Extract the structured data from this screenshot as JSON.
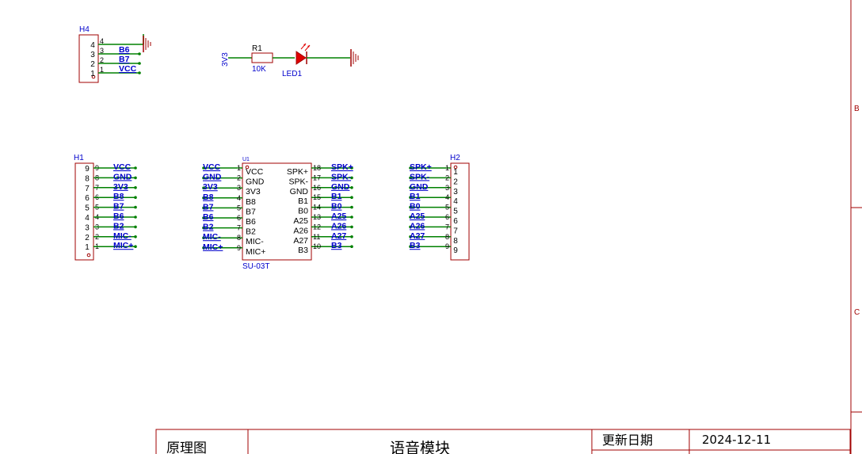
{
  "colors": {
    "body_stroke": "#a00000",
    "wire": "#008000",
    "net_label": "#0000cc",
    "text": "#000000",
    "frame": "#a00000",
    "led_fill": "#e00000"
  },
  "border_letters": [
    "B",
    "C"
  ],
  "h4": {
    "ref": "H4",
    "pins": [
      {
        "num": "4",
        "net": ""
      },
      {
        "num": "3",
        "net": "B6"
      },
      {
        "num": "2",
        "net": "B7"
      },
      {
        "num": "1",
        "net": "VCC"
      }
    ]
  },
  "power": {
    "net": "3V3",
    "resistor_ref": "R1",
    "resistor_value": "10K",
    "led_ref": "LED1"
  },
  "h1": {
    "ref": "H1",
    "pins": [
      {
        "num": "9",
        "net": "VCC"
      },
      {
        "num": "8",
        "net": "GND"
      },
      {
        "num": "7",
        "net": "3V3"
      },
      {
        "num": "6",
        "net": "B8"
      },
      {
        "num": "5",
        "net": "B7"
      },
      {
        "num": "4",
        "net": "B6"
      },
      {
        "num": "3",
        "net": "B2"
      },
      {
        "num": "2",
        "net": "MIC-"
      },
      {
        "num": "1",
        "net": "MIC+"
      }
    ]
  },
  "u1": {
    "ref": "U1",
    "value": "SU-03T",
    "left_pins": [
      {
        "num": "1",
        "name": "VCC",
        "net": "VCC"
      },
      {
        "num": "2",
        "name": "GND",
        "net": "GND"
      },
      {
        "num": "3",
        "name": "3V3",
        "net": "3V3"
      },
      {
        "num": "4",
        "name": "B8",
        "net": "B8"
      },
      {
        "num": "5",
        "name": "B7",
        "net": "B7"
      },
      {
        "num": "6",
        "name": "B6",
        "net": "B6"
      },
      {
        "num": "7",
        "name": "B2",
        "net": "B2"
      },
      {
        "num": "8",
        "name": "MIC-",
        "net": "MIC-"
      },
      {
        "num": "9",
        "name": "MIC+",
        "net": "MIC+"
      }
    ],
    "right_pins": [
      {
        "num": "18",
        "name": "SPK+",
        "net": "SPK+"
      },
      {
        "num": "17",
        "name": "SPK-",
        "net": "SPK-"
      },
      {
        "num": "16",
        "name": "GND",
        "net": "GND"
      },
      {
        "num": "15",
        "name": "B1",
        "net": "B1"
      },
      {
        "num": "14",
        "name": "B0",
        "net": "B0"
      },
      {
        "num": "13",
        "name": "A25",
        "net": "A25"
      },
      {
        "num": "12",
        "name": "A26",
        "net": "A26"
      },
      {
        "num": "11",
        "name": "A27",
        "net": "A27"
      },
      {
        "num": "10",
        "name": "B3",
        "net": "B3"
      }
    ]
  },
  "h2": {
    "ref": "H2",
    "pins": [
      {
        "num": "1",
        "net": "SPK+"
      },
      {
        "num": "2",
        "net": "SPK-"
      },
      {
        "num": "3",
        "net": "GND"
      },
      {
        "num": "4",
        "net": "B1"
      },
      {
        "num": "5",
        "net": "B0"
      },
      {
        "num": "6",
        "net": "A25"
      },
      {
        "num": "7",
        "net": "A26"
      },
      {
        "num": "8",
        "net": "A27"
      },
      {
        "num": "9",
        "net": "B3"
      }
    ]
  },
  "title_block": {
    "type_label": "原理图",
    "title": "语音模块",
    "date_label": "更新日期",
    "date_value": "2024-12-11"
  }
}
